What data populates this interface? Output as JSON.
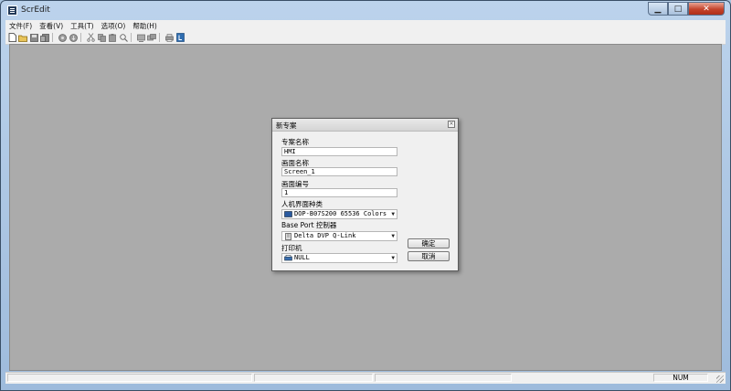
{
  "window": {
    "title": "ScrEdit",
    "controls": {
      "minimize": "▁",
      "maximize": "□",
      "close": "✕"
    }
  },
  "menu": [
    {
      "label": "文件(F)"
    },
    {
      "label": "查看(V)"
    },
    {
      "label": "工具(T)"
    },
    {
      "label": "选项(O)"
    },
    {
      "label": "帮助(H)"
    }
  ],
  "toolbar": {
    "icons": [
      "new-file-icon",
      "open-folder-icon",
      "save-icon",
      "save-as-icon",
      "compile-icon",
      "download-icon",
      "cut-icon",
      "copy-icon",
      "paste-icon",
      "zoom-icon",
      "screen-prev-icon",
      "screen-next-icon",
      "print-icon",
      "about-icon"
    ]
  },
  "dialog": {
    "title": "新专案",
    "close": "×",
    "project_name_label": "专案名称",
    "project_name_value": "HMI",
    "screen_name_label": "画面名称",
    "screen_name_value": "Screen_1",
    "screen_no_label": "画面编号",
    "screen_no_value": "1",
    "hmi_type_label": "人机界面种类",
    "hmi_type_value": "DOP-B07S200 65536 Colors",
    "base_port_label": "Base Port 控制器",
    "base_port_value": "Delta DVP Q-Link",
    "printer_label": "打印机",
    "printer_value": "NULL",
    "ok_label": "确定",
    "cancel_label": "取消"
  },
  "statusbar": {
    "num": "NUM"
  }
}
